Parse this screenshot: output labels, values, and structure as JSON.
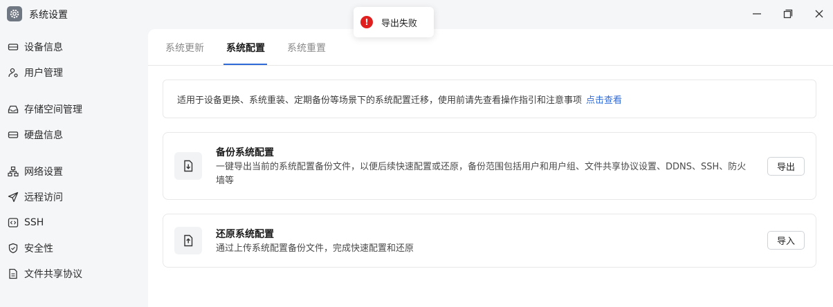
{
  "window": {
    "title": "系统设置",
    "app_icon": "gear-icon",
    "controls": [
      "minimize-icon",
      "maximize-icon",
      "close-icon"
    ]
  },
  "sidebar": {
    "items": [
      {
        "label": "设备信息",
        "icon": "device-icon"
      },
      {
        "label": "用户管理",
        "icon": "users-icon"
      },
      {
        "label": "存储空间管理",
        "icon": "storage-icon"
      },
      {
        "label": "硬盘信息",
        "icon": "disk-icon"
      },
      {
        "label": "网络设置",
        "icon": "network-icon"
      },
      {
        "label": "远程访问",
        "icon": "send-icon"
      },
      {
        "label": "SSH",
        "icon": "code-icon"
      },
      {
        "label": "安全性",
        "icon": "shield-icon"
      },
      {
        "label": "文件共享协议",
        "icon": "file-icon"
      }
    ]
  },
  "tabs": [
    {
      "label": "系统更新",
      "active": false
    },
    {
      "label": "系统配置",
      "active": true
    },
    {
      "label": "系统重置",
      "active": false
    }
  ],
  "notice": {
    "text": "适用于设备更换、系统重装、定期备份等场景下的系统配置迁移，使用前请先查看操作指引和注意事项",
    "link": "点击查看"
  },
  "backup": {
    "title": "备份系统配置",
    "description": "一键导出当前的系统配置备份文件，以便后续快速配置或还原，备份范围包括用户和用户组、文件共享协议设置、DDNS、SSH、防火墙等",
    "button": "导出",
    "icon": "download-file-icon"
  },
  "restore": {
    "title": "还原系统配置",
    "description": "通过上传系统配置备份文件，完成快速配置和还原",
    "button": "导入",
    "icon": "upload-file-icon"
  },
  "toast": {
    "message": "导出失败",
    "icon_glyph": "!",
    "icon": "error-icon"
  },
  "colors": {
    "accent": "#2f6bd8",
    "error": "#e0201f",
    "sidebar_bg": "#f5f6f8"
  }
}
